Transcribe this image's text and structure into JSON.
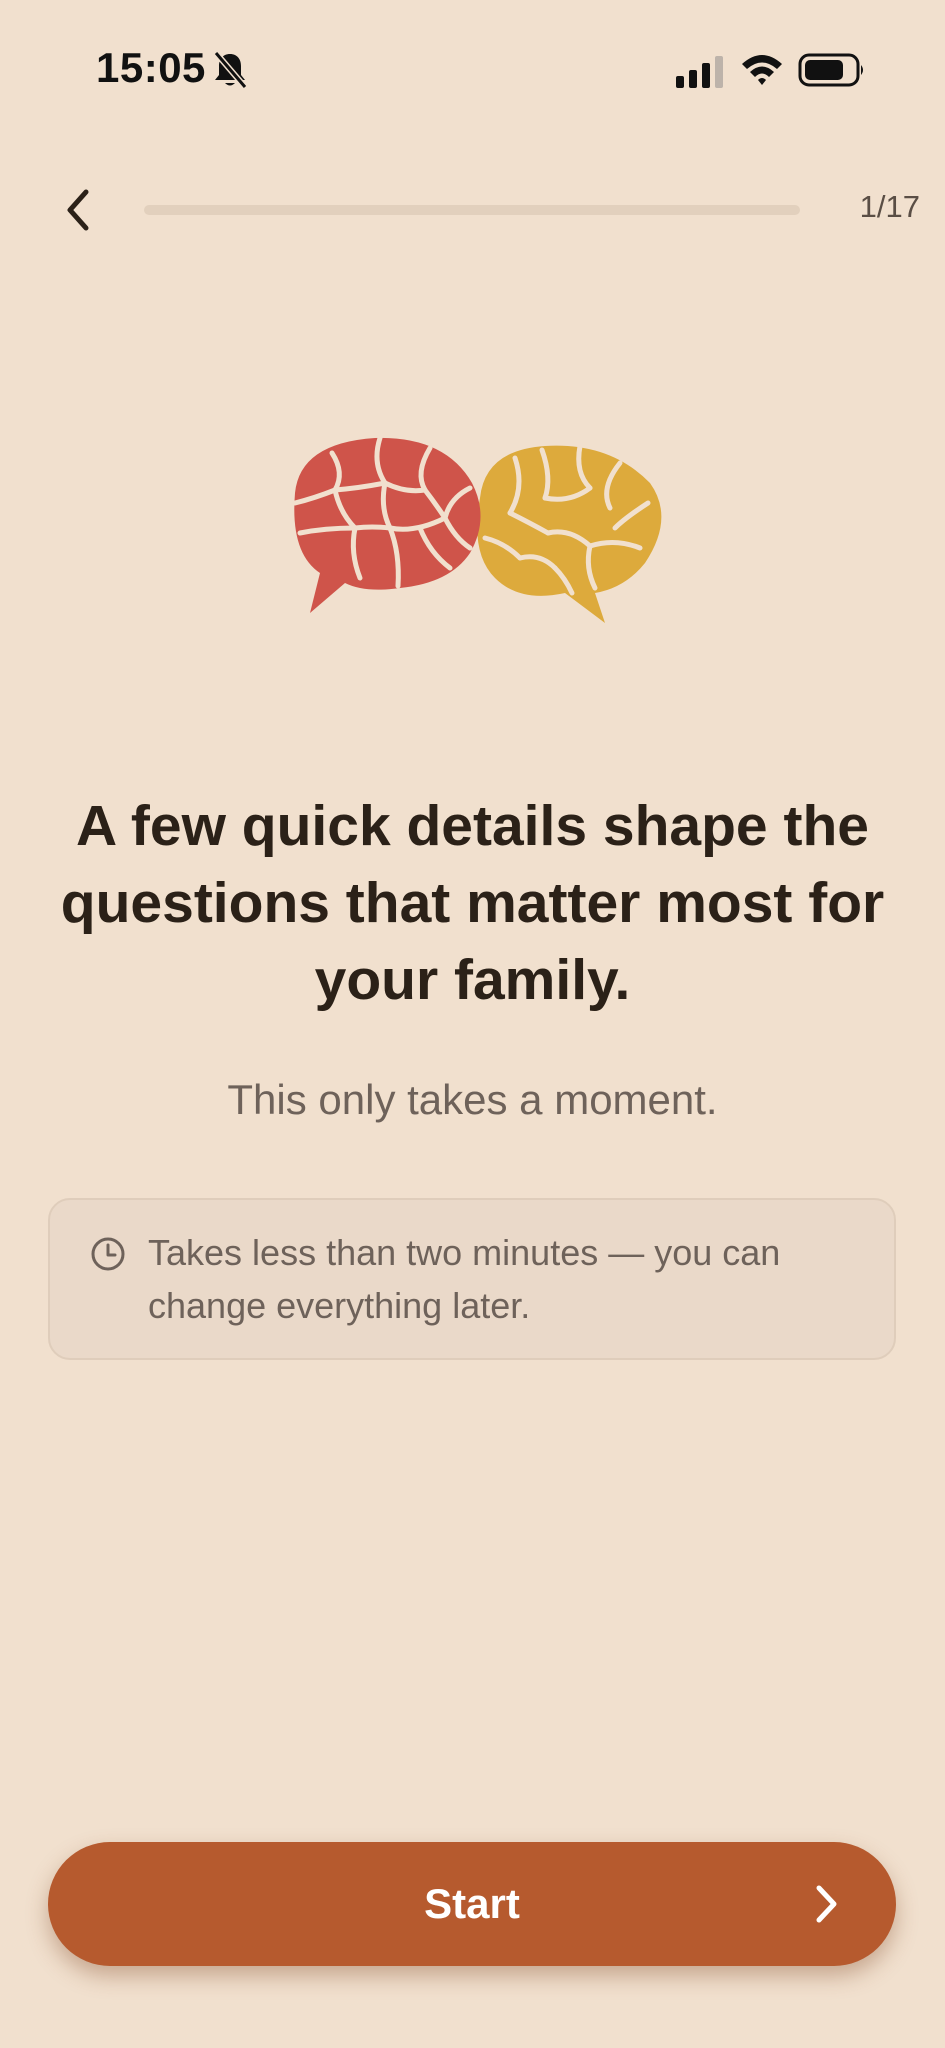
{
  "status_bar": {
    "time": "15:05",
    "icons": [
      "bell-off-icon",
      "signal-icon",
      "wifi-icon",
      "battery-icon"
    ]
  },
  "nav": {
    "back_icon": "chevron-left-icon",
    "step_counter": "1/17",
    "progress": 0.0
  },
  "illustration": {
    "icon": "speech-bubbles-icon",
    "colors": {
      "left_bubble": "#CF544A",
      "right_bubble": "#DDAA3C"
    }
  },
  "content": {
    "headline": "A few quick details shape the questions that matter most for your family.",
    "subtitle": "This only takes a moment.",
    "info": {
      "icon": "clock-icon",
      "text": "Takes less than two minutes — you can change everything later."
    }
  },
  "footer": {
    "start_label": "Start",
    "chevron_icon": "chevron-right-icon"
  },
  "colors": {
    "background": "#F1E0CE",
    "accent": "#B65A2E",
    "text_primary": "#2B2118",
    "text_secondary": "#6E625A"
  }
}
